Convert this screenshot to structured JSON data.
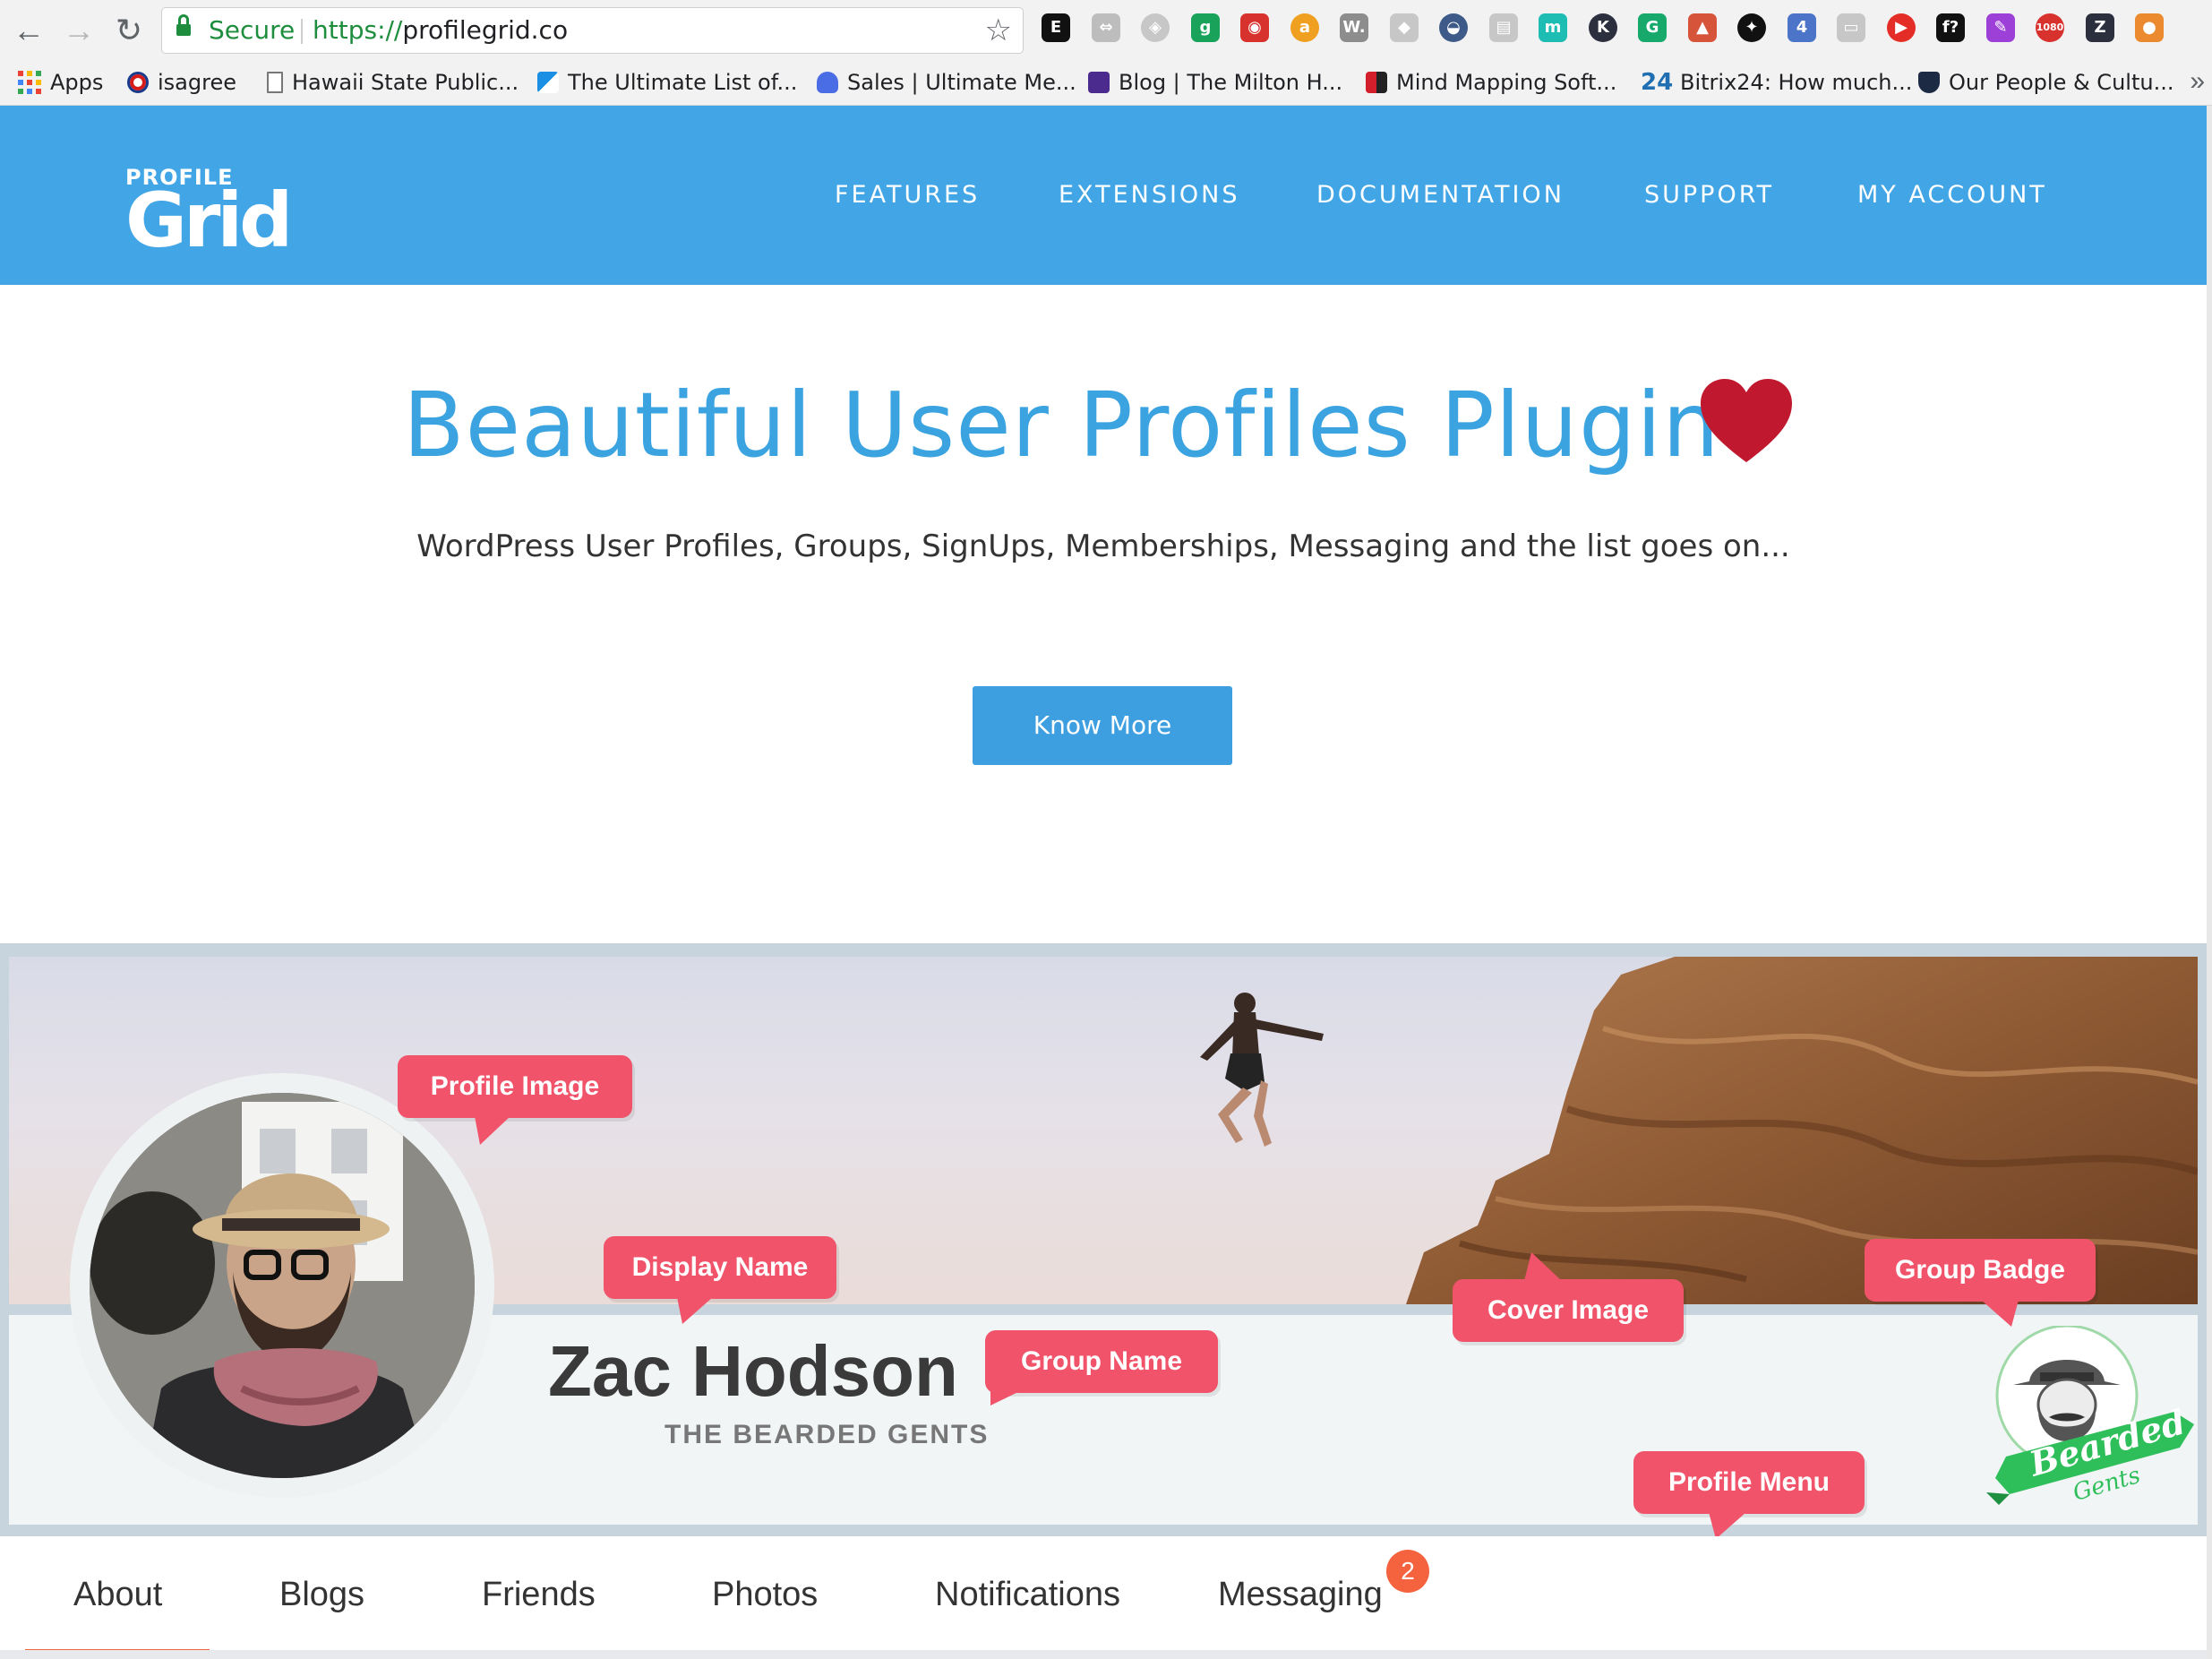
{
  "browser": {
    "secure_label": "Secure",
    "url_scheme": "https://",
    "url_host": "profilegrid.co",
    "bookmarks": [
      {
        "label": "Apps",
        "icon": "apps-grid-icon"
      },
      {
        "label": "isagree",
        "icon": "red-dot-icon"
      },
      {
        "label": "Hawaii State Public...",
        "icon": "page-icon"
      },
      {
        "label": "The Ultimate List of...",
        "icon": "paper-plane-icon"
      },
      {
        "label": "Sales | Ultimate Me...",
        "icon": "plug-icon"
      },
      {
        "label": "Blog | The Milton H...",
        "icon": "milton-icon"
      },
      {
        "label": "Mind Mapping Soft...",
        "icon": "mindmap-icon"
      },
      {
        "label": "Bitrix24: How much...",
        "icon": "bitrix24-icon"
      },
      {
        "label": "Our People & Cultu...",
        "icon": "shield-b-icon"
      }
    ],
    "extensions": [
      {
        "name": "evernote-extension-icon",
        "glyph": "E",
        "color": "#111111"
      },
      {
        "name": "arrows-extension-icon",
        "glyph": "⇔",
        "color": "#bdbdbd"
      },
      {
        "name": "pocket-extension-icon",
        "glyph": "◈",
        "color": "#c7c7c7"
      },
      {
        "name": "grammar-extension-icon",
        "glyph": "g",
        "color": "#19a35a"
      },
      {
        "name": "lastpass-extension-icon",
        "glyph": "◉",
        "color": "#d8322f"
      },
      {
        "name": "amazon-extension-icon",
        "glyph": "a",
        "color": "#f0a020"
      },
      {
        "name": "wappalyzer-extension-icon",
        "glyph": "W.",
        "color": "#8d8d8d"
      },
      {
        "name": "dropbox-extension-icon",
        "glyph": "◆",
        "color": "#c7c7c7"
      },
      {
        "name": "wave-extension-icon",
        "glyph": "◒",
        "color": "#3d5a88"
      },
      {
        "name": "clipboard-extension-icon",
        "glyph": "▤",
        "color": "#c7c7c7"
      },
      {
        "name": "m-extension-icon",
        "glyph": "m",
        "color": "#1dbdb3"
      },
      {
        "name": "k-extension-icon",
        "glyph": "K",
        "color": "#2b2f3e"
      },
      {
        "name": "grammarly-extension-icon",
        "glyph": "G",
        "color": "#17a86b"
      },
      {
        "name": "pdf-extension-icon",
        "glyph": "▲",
        "color": "#d6543a"
      },
      {
        "name": "bird-extension-icon",
        "glyph": "✦",
        "color": "#111111"
      },
      {
        "name": "tab-counter-extension-icon",
        "glyph": "4",
        "color": "#4c74c9"
      },
      {
        "name": "screen-extension-icon",
        "glyph": "▭",
        "color": "#c7c7c7"
      },
      {
        "name": "youtube-extension-icon",
        "glyph": "▶",
        "color": "#e52d27"
      },
      {
        "name": "fonts-extension-icon",
        "glyph": "f?",
        "color": "#111111"
      },
      {
        "name": "dropper-extension-icon",
        "glyph": "✎",
        "color": "#9c40d8"
      },
      {
        "name": "1080-extension-icon",
        "glyph": "1080",
        "color": "#d8322f"
      },
      {
        "name": "zoom-extension-icon",
        "glyph": "Z",
        "color": "#2b2f3e"
      },
      {
        "name": "basketball-extension-icon",
        "glyph": "●",
        "color": "#ec8a2f"
      }
    ]
  },
  "site": {
    "logo_top": "PROFILE",
    "logo_main": "Grid",
    "nav": [
      "FEATURES",
      "EXTENSIONS",
      "DOCUMENTATION",
      "SUPPORT",
      "MY ACCOUNT"
    ],
    "brand_color": "#42a5e6"
  },
  "hero": {
    "title": "Beautiful User Profiles Plugin",
    "subtitle": "WordPress User Profiles, Groups, SignUps, Memberships, Messaging and the list goes on...",
    "cta": "Know More",
    "heart_color": "#c0182e"
  },
  "profile_demo": {
    "display_name": "Zac Hodson",
    "group_name": "THE BEARDED GENTS",
    "badge_word": "Bearded",
    "badge_subword": "Gents",
    "callouts": {
      "profile_image": "Profile Image",
      "display_name": "Display Name",
      "group_name": "Group Name",
      "cover_image": "Cover Image",
      "group_badge": "Group Badge",
      "profile_menu": "Profile Menu"
    },
    "callout_color": "#f0536a",
    "tabs": [
      "About",
      "Blogs",
      "Friends",
      "Photos",
      "Notifications",
      "Messaging"
    ],
    "messaging_count": "2",
    "active_tab": "About",
    "accent_color": "#f2643c"
  }
}
